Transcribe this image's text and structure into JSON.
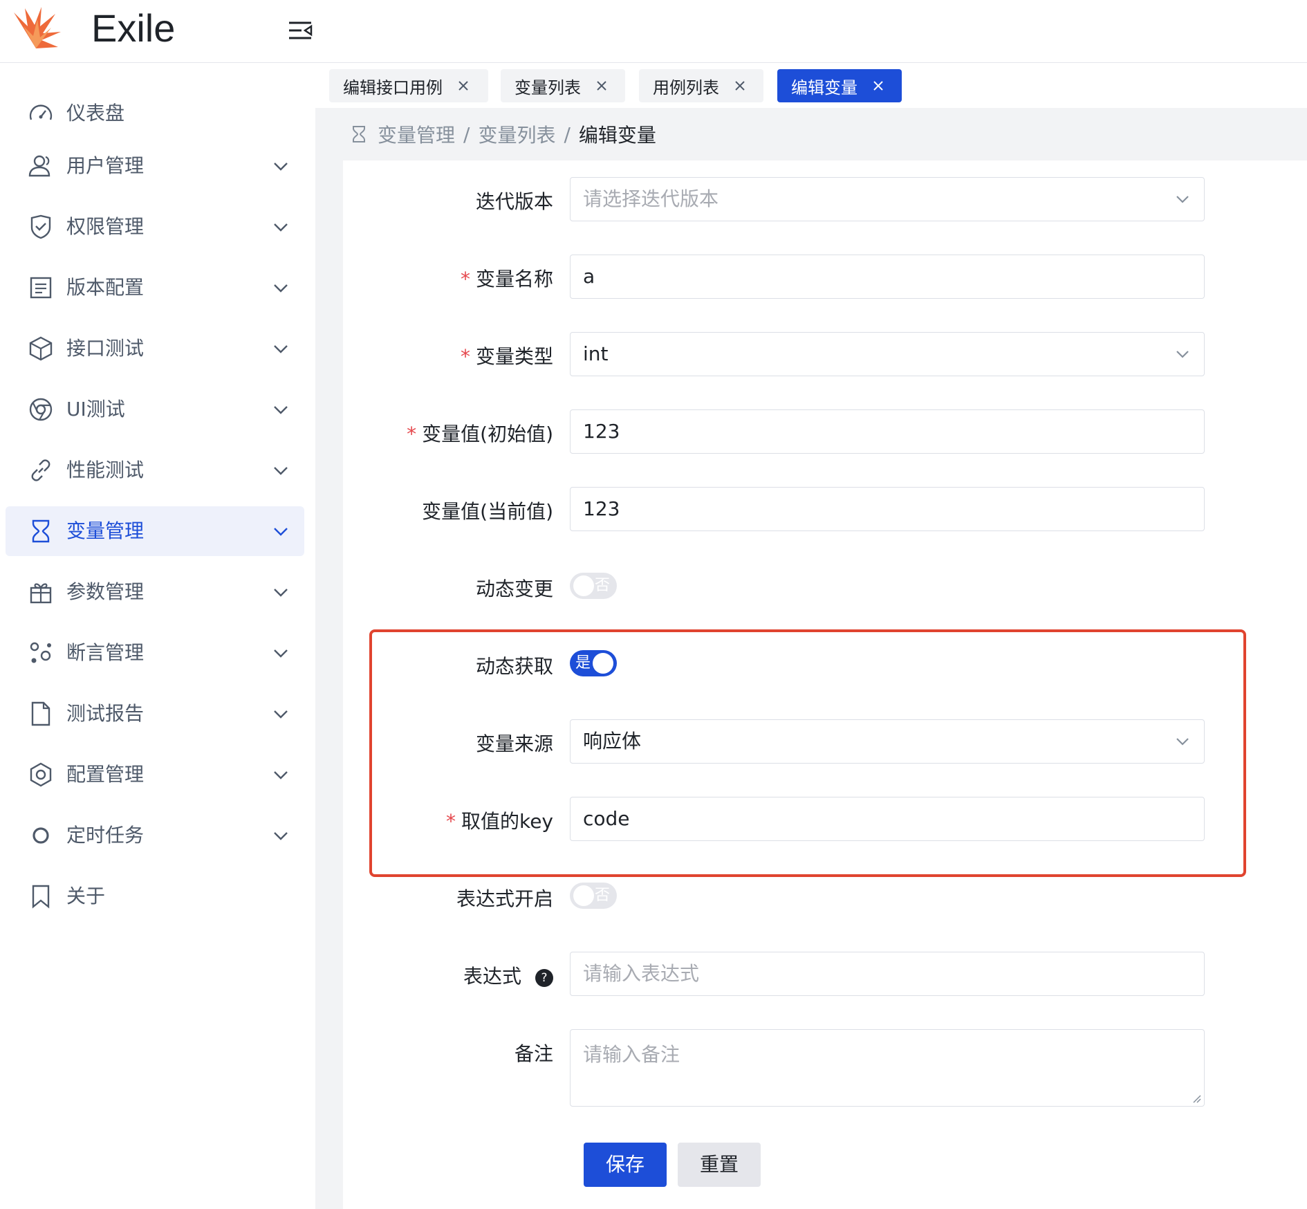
{
  "app": {
    "title": "Exile"
  },
  "sidebar": {
    "items": [
      {
        "label": "仪表盘",
        "icon": "dashboard-icon",
        "has_children": false,
        "active": false
      },
      {
        "label": "用户管理",
        "icon": "user-icon",
        "has_children": true,
        "active": false
      },
      {
        "label": "权限管理",
        "icon": "shield-icon",
        "has_children": true,
        "active": false
      },
      {
        "label": "版本配置",
        "icon": "document-list-icon",
        "has_children": true,
        "active": false
      },
      {
        "label": "接口测试",
        "icon": "cube-icon",
        "has_children": true,
        "active": false
      },
      {
        "label": "UI测试",
        "icon": "chrome-icon",
        "has_children": true,
        "active": false
      },
      {
        "label": "性能测试",
        "icon": "link-icon",
        "has_children": true,
        "active": false
      },
      {
        "label": "变量管理",
        "icon": "hourglass-icon",
        "has_children": true,
        "active": true
      },
      {
        "label": "参数管理",
        "icon": "gift-icon",
        "has_children": true,
        "active": false
      },
      {
        "label": "断言管理",
        "icon": "nodes-icon",
        "has_children": true,
        "active": false
      },
      {
        "label": "测试报告",
        "icon": "file-icon",
        "has_children": true,
        "active": false
      },
      {
        "label": "配置管理",
        "icon": "settings-icon",
        "has_children": true,
        "active": false
      },
      {
        "label": "定时任务",
        "icon": "circle-icon",
        "has_children": true,
        "active": false
      },
      {
        "label": "关于",
        "icon": "bookmark-icon",
        "has_children": false,
        "active": false
      }
    ]
  },
  "tabs": [
    {
      "label": "编辑接口用例",
      "active": false
    },
    {
      "label": "变量列表",
      "active": false
    },
    {
      "label": "用例列表",
      "active": false
    },
    {
      "label": "编辑变量",
      "active": true
    }
  ],
  "breadcrumb": {
    "items": [
      "变量管理",
      "变量列表"
    ],
    "current": "编辑变量",
    "separator": "/"
  },
  "form": {
    "iteration": {
      "label": "迭代版本",
      "placeholder": "请选择迭代版本",
      "value": ""
    },
    "var_name": {
      "label": "变量名称",
      "required": true,
      "value": "a"
    },
    "var_type": {
      "label": "变量类型",
      "required": true,
      "value": "int"
    },
    "init_value": {
      "label": "变量值(初始值)",
      "required": true,
      "value": "123"
    },
    "current_value": {
      "label": "变量值(当前值)",
      "value": "123"
    },
    "dynamic_change": {
      "label": "动态变更",
      "on": false,
      "text": "否"
    },
    "dynamic_fetch": {
      "label": "动态获取",
      "on": true,
      "text": "是"
    },
    "var_source": {
      "label": "变量来源",
      "value": "响应体"
    },
    "value_key": {
      "label": "取值的key",
      "required": true,
      "value": "code"
    },
    "expression_enabled": {
      "label": "表达式开启",
      "on": false,
      "text": "否"
    },
    "expression": {
      "label": "表达式",
      "placeholder": "请输入表达式",
      "help": "?"
    },
    "remark": {
      "label": "备注",
      "placeholder": "请输入备注"
    },
    "required_mark": "*"
  },
  "buttons": {
    "save": "保存",
    "reset": "重置"
  },
  "colors": {
    "primary": "#1d4ed8",
    "highlight": "#e0442f",
    "required": "#e5484d"
  }
}
